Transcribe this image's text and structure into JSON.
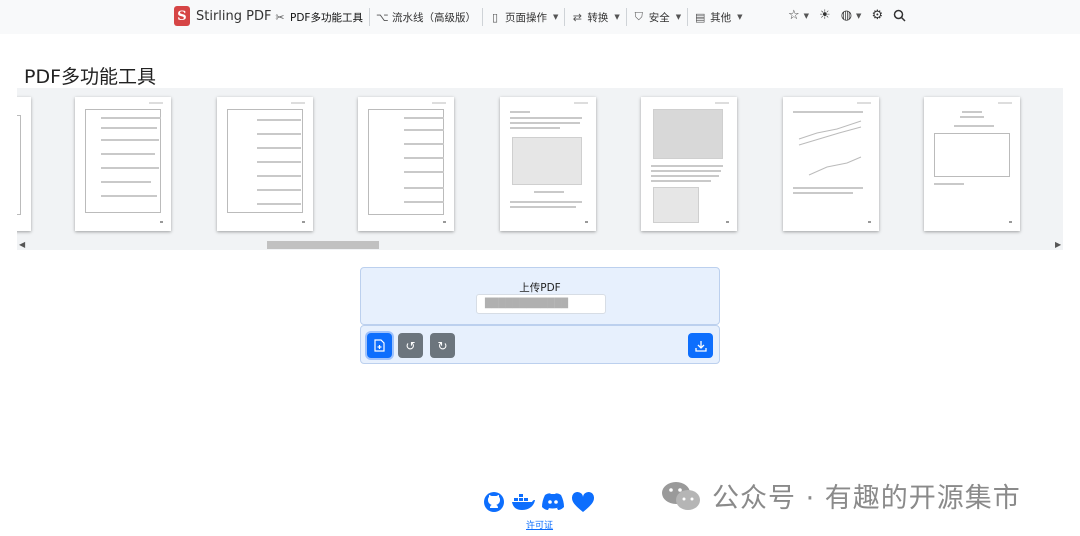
{
  "navbar": {
    "brand": "Stirling PDF",
    "items": [
      {
        "label": "PDF多功能工具",
        "icon": "tools-icon",
        "caret": false
      },
      {
        "label": "流水线（高级版）",
        "icon": "pipeline-icon",
        "caret": false
      },
      {
        "label": "页面操作",
        "icon": "page-icon",
        "caret": true
      },
      {
        "label": "转换",
        "icon": "convert-icon",
        "caret": true
      },
      {
        "label": "安全",
        "icon": "shield-icon",
        "caret": true
      },
      {
        "label": "其他",
        "icon": "other-icon",
        "caret": true
      }
    ]
  },
  "page_title": "PDF多功能工具",
  "upload": {
    "label": "上传PDF",
    "file_name": "████████████"
  },
  "footer": {
    "license": "许可证"
  },
  "watermark": {
    "text": "公众号 · 有趣的开源集市"
  },
  "colors": {
    "accent": "#0d6efd",
    "brand": "#d64545",
    "panel": "#e7f0fd"
  }
}
